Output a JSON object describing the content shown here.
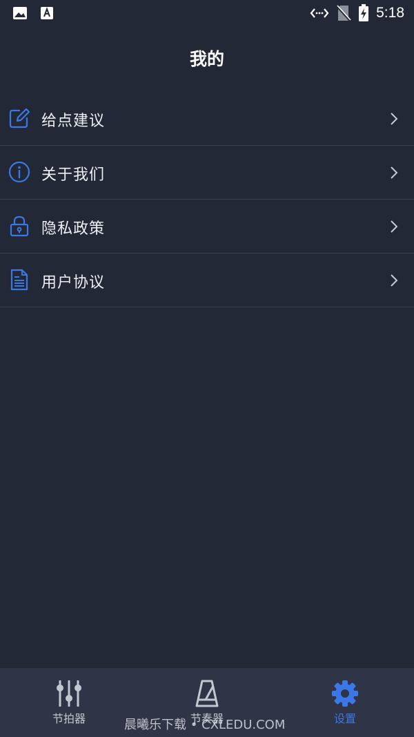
{
  "status_bar": {
    "time": "5:18",
    "left_icons": [
      "image-icon",
      "text-a-icon"
    ],
    "right_icons": [
      "code-arrows-icon",
      "no-sim-icon",
      "battery-charging-icon"
    ]
  },
  "header": {
    "title": "我的"
  },
  "menu": {
    "items": [
      {
        "label": "给点建议",
        "icon": "edit-icon"
      },
      {
        "label": "关于我们",
        "icon": "info-icon"
      },
      {
        "label": "隐私政策",
        "icon": "lock-icon"
      },
      {
        "label": "用户协议",
        "icon": "document-icon"
      }
    ]
  },
  "bottom_nav": {
    "items": [
      {
        "label": "节拍器",
        "icon": "sliders-icon",
        "active": false
      },
      {
        "label": "节奏器",
        "icon": "metronome-icon",
        "active": false
      },
      {
        "label": "设置",
        "icon": "gear-icon",
        "active": true
      }
    ]
  },
  "colors": {
    "background": "#232836",
    "nav_background": "#2f3547",
    "accent": "#3b78e7",
    "divider": "#3c4252"
  },
  "watermark": "晨曦乐下载 • CXLEDU.COM"
}
